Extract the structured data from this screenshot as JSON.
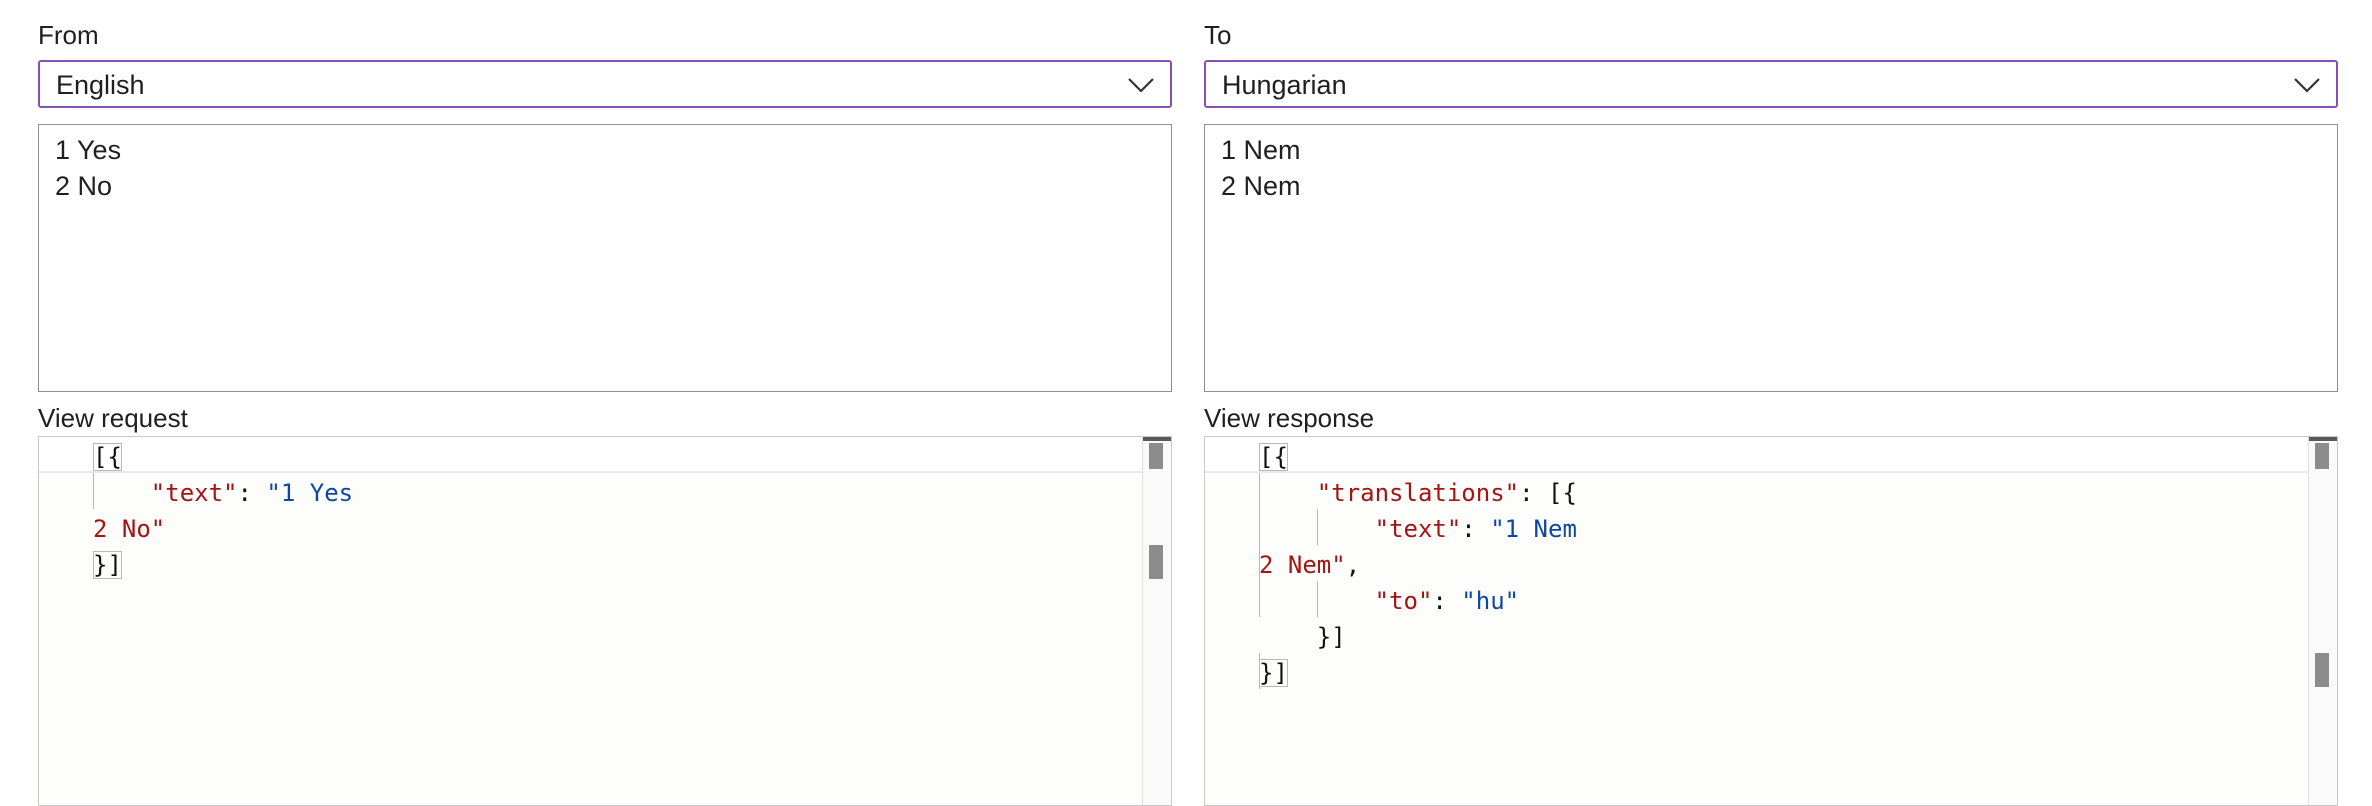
{
  "from": {
    "label": "From",
    "selected_language": "English",
    "input_text": "1 Yes\n2 No"
  },
  "to": {
    "label": "To",
    "selected_language": "Hungarian",
    "output_text": "1 Nem\n2 Nem"
  },
  "request": {
    "label": "View request",
    "code": {
      "l1_open": "[{",
      "l2_key": "\"text\"",
      "l2_colon": ": ",
      "l2_value": "\"1 Yes",
      "l3_value": "2 No\"",
      "l4_close": "}]"
    }
  },
  "response": {
    "label": "View response",
    "code": {
      "l1_open": "[{",
      "l2_key": "\"translations\"",
      "l2_rest": ": [{",
      "l3_key": "\"text\"",
      "l3_colon": ": ",
      "l3_value": "\"1 Nem",
      "l4_value": "2 Nem\"",
      "l4_comma": ",",
      "l5_key": "\"to\"",
      "l5_colon": ": ",
      "l5_value": "\"hu\"",
      "l6_close": "}]",
      "l7_close": "}]"
    }
  },
  "icons": {
    "dropdown": "chevron-down-icon"
  },
  "colors": {
    "select_border": "#8a4fb5",
    "json_key": "#a31515",
    "json_string": "#0d47a1"
  }
}
